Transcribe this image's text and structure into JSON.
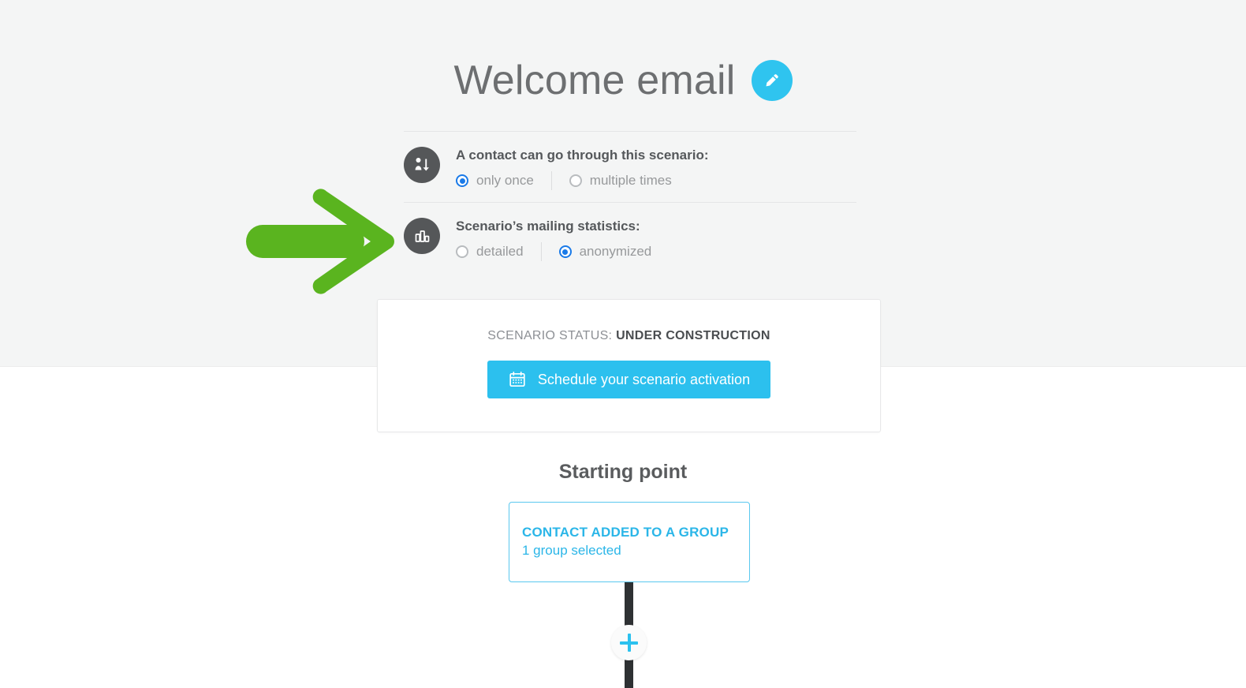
{
  "header": {
    "title": "Welcome email",
    "edit_icon": "pencil-icon",
    "edit_button_color": "#2fc4ef"
  },
  "settings": [
    {
      "icon": "contact-flow-icon",
      "label": "A contact can go through this scenario:",
      "options": [
        {
          "label": "only once",
          "selected": true
        },
        {
          "label": "multiple times",
          "selected": false
        }
      ]
    },
    {
      "icon": "bar-chart-icon",
      "label": "Scenario’s mailing statistics:",
      "options": [
        {
          "label": "detailed",
          "selected": false
        },
        {
          "label": "anonymized",
          "selected": true
        }
      ]
    }
  ],
  "status_card": {
    "status_prefix": "SCENARIO STATUS:",
    "status_value": "UNDER CONSTRUCTION",
    "button_label": "Schedule your scenario activation",
    "button_icon": "calendar-icon",
    "button_color": "#2cc0ee"
  },
  "flow": {
    "section_title": "Starting point",
    "start_node": {
      "title": "CONTACT ADDED TO A GROUP",
      "subtitle": "1 group selected",
      "accent_color": "#2bb6e8"
    },
    "add_step_icon": "plus-icon"
  },
  "annotation": {
    "arrow": "green-arrow-right",
    "color": "#5ab41f"
  },
  "colors": {
    "band_background": "#f4f5f5",
    "page_background": "#ffffff",
    "radio_selected": "#1a7ae8",
    "icon_circle": "#555759"
  }
}
